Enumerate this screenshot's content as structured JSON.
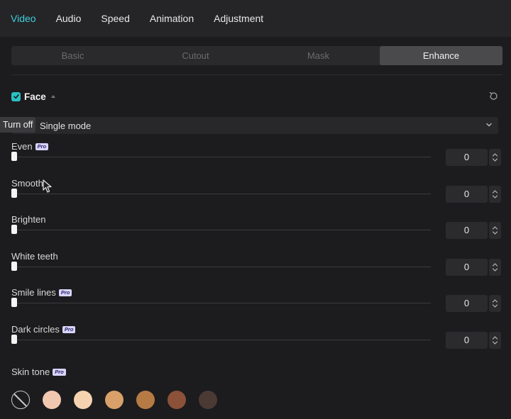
{
  "tabs": [
    "Video",
    "Audio",
    "Speed",
    "Animation",
    "Adjustment"
  ],
  "subtabs": [
    "Basic",
    "Cutout",
    "Mask",
    "Enhance"
  ],
  "face": {
    "label": "Face",
    "checked": true
  },
  "mode": {
    "value": "Single mode",
    "tooltip": "Turn off"
  },
  "sliders": [
    {
      "label": "Even",
      "pro": "Pro",
      "value": "0"
    },
    {
      "label": "Smooth",
      "pro": "",
      "value": "0"
    },
    {
      "label": "Brighten",
      "pro": "",
      "value": "0"
    },
    {
      "label": "White teeth",
      "pro": "",
      "value": "0"
    },
    {
      "label": "Smile lines",
      "pro": "Pro",
      "value": "0"
    },
    {
      "label": "Dark circles",
      "pro": "Pro",
      "value": "0"
    }
  ],
  "skin_tone": {
    "label": "Skin tone",
    "pro": "Pro",
    "colors": [
      "#f2c7b0",
      "#f6d3b0",
      "#d9a06a",
      "#b67b45",
      "#8b5139",
      "#4b3a34"
    ]
  },
  "colors": {
    "accent": "#3fd0d8",
    "checkbox": "#2bbfc4"
  }
}
